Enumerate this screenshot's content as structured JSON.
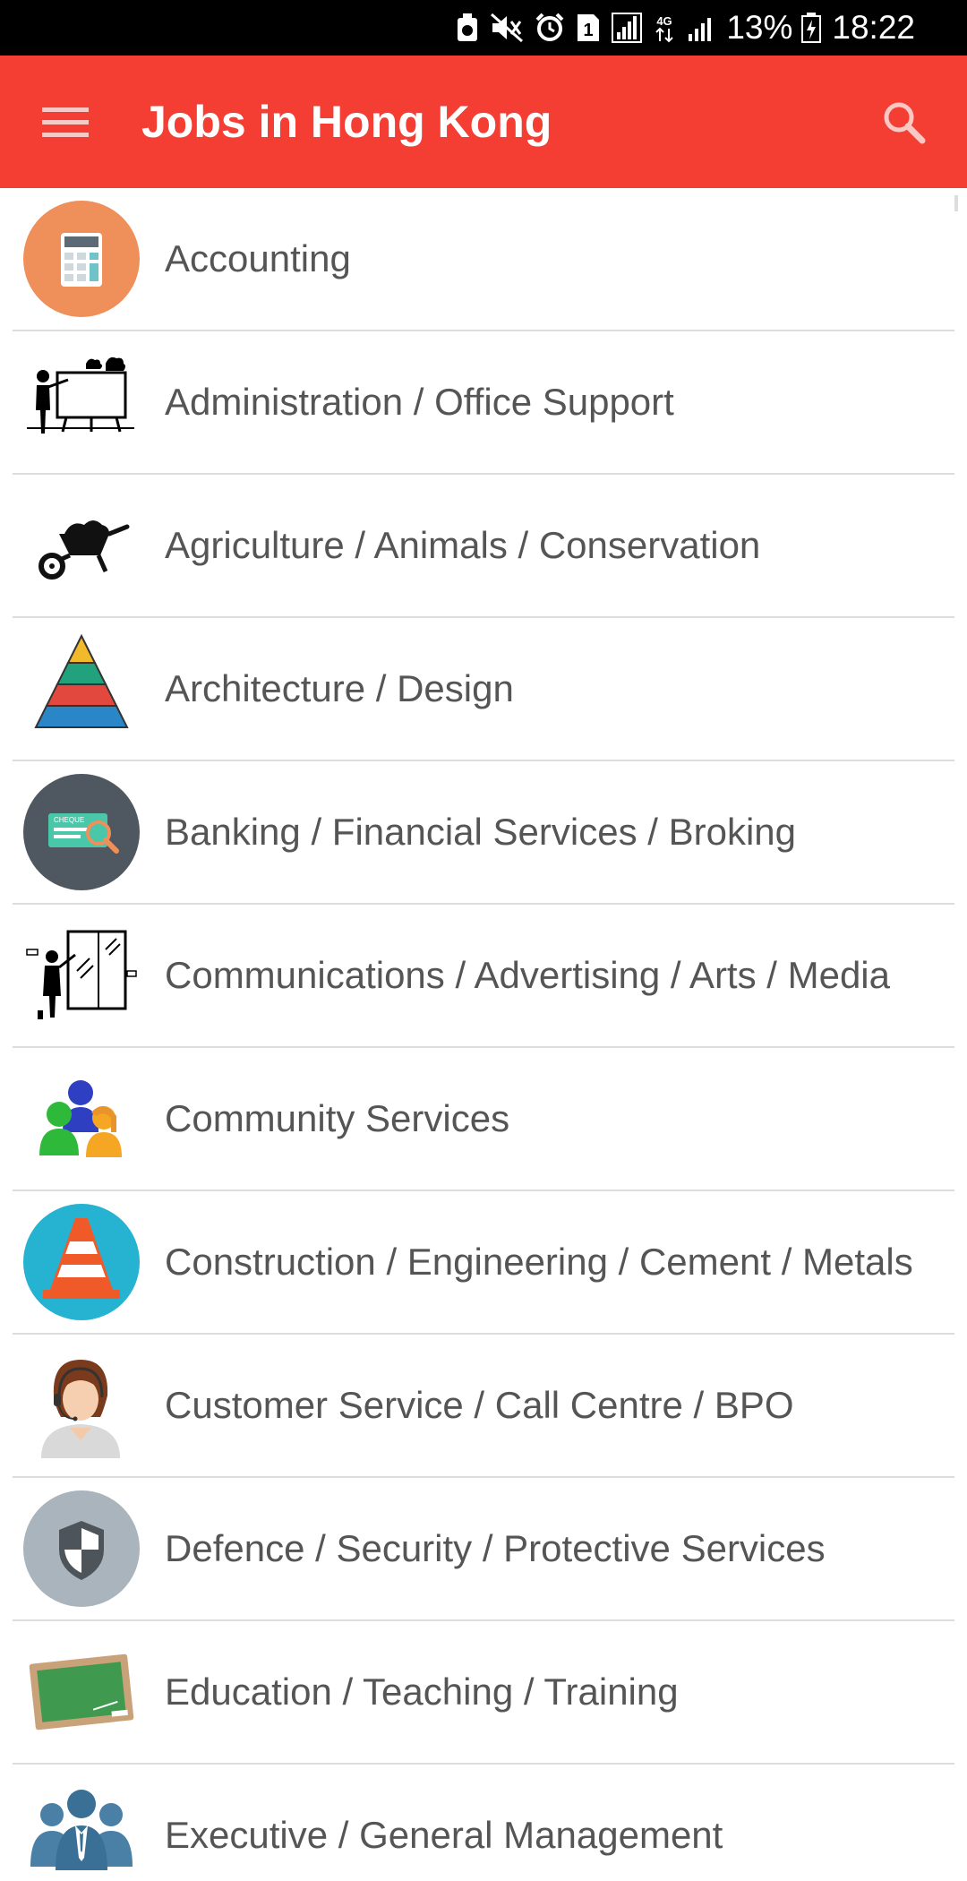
{
  "status_bar": {
    "network_label": "4G",
    "battery_percent": "13%",
    "time": "18:22",
    "icons": [
      "recycle-icon",
      "mute-icon",
      "alarm-icon",
      "sim-1-icon",
      "signal-icon",
      "data-arrows-icon",
      "signal-icon",
      "battery-charging-icon"
    ]
  },
  "app_bar": {
    "title": "Jobs in Hong Kong",
    "menu_icon": "hamburger-menu-icon",
    "search_icon": "search-icon",
    "background_color": "#f43d33"
  },
  "categories": [
    {
      "label": "Accounting",
      "icon": "calculator-icon"
    },
    {
      "label": "Administration / Office Support",
      "icon": "presenter-board-icon"
    },
    {
      "label": "Agriculture / Animals / Conservation",
      "icon": "wheelbarrow-icon"
    },
    {
      "label": "Architecture / Design",
      "icon": "pyramid-icon"
    },
    {
      "label": "Banking / Financial Services / Broking",
      "icon": "cheque-icon"
    },
    {
      "label": "Communications / Advertising / Arts / Media",
      "icon": "presenter-window-icon"
    },
    {
      "label": "Community Services",
      "icon": "people-group-icon"
    },
    {
      "label": "Construction / Engineering / Cement / Metals",
      "icon": "traffic-cone-icon"
    },
    {
      "label": "Customer Service / Call Centre / BPO",
      "icon": "call-centre-agent-icon"
    },
    {
      "label": "Defence / Security / Protective Services",
      "icon": "shield-icon"
    },
    {
      "label": "Education / Teaching / Training",
      "icon": "chalkboard-icon"
    },
    {
      "label": "Executive / General Management",
      "icon": "business-people-icon"
    }
  ]
}
